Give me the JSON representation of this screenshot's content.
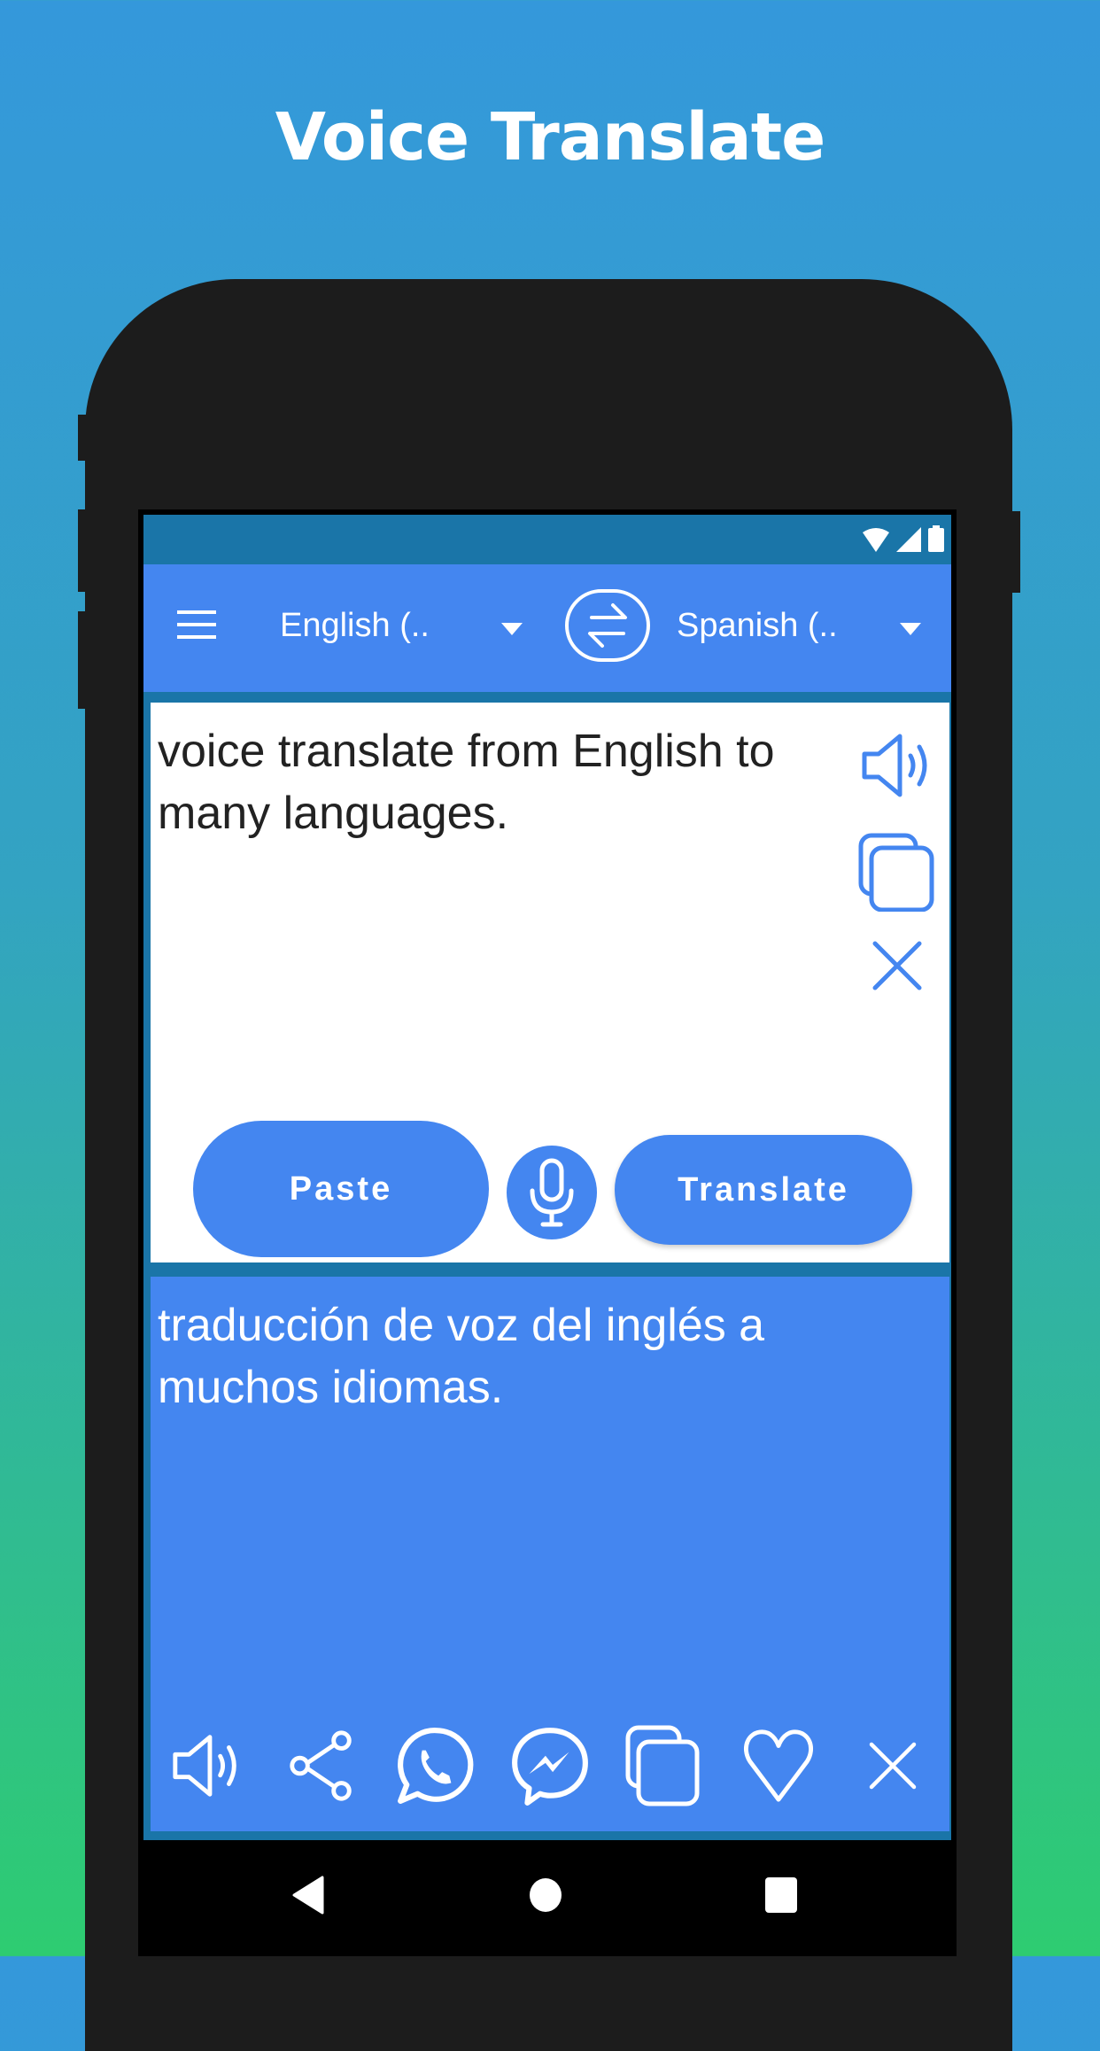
{
  "promo": {
    "title": "Voice Translate"
  },
  "status_bar": {
    "icons": [
      "wifi-icon",
      "signal-icon",
      "battery-icon"
    ]
  },
  "app_bar": {
    "menu_icon": "hamburger-menu-icon",
    "source_language": "English (..",
    "target_language": "Spanish (..",
    "swap_icon": "swap-languages-icon"
  },
  "input": {
    "text": "voice translate from English to many languages.",
    "actions": [
      "speaker-icon",
      "copy-icon",
      "clear-icon"
    ],
    "paste_label": "Paste",
    "translate_label": "Translate",
    "mic_icon": "microphone-icon"
  },
  "output": {
    "text": "traducción de voz del inglés a muchos idiomas.",
    "actions": [
      "speaker-icon",
      "share-icon",
      "whatsapp-icon",
      "messenger-icon",
      "copy-icon",
      "favorite-heart-icon",
      "clear-icon"
    ]
  },
  "colors": {
    "primary": "#4486f0",
    "primary_dark": "#1a75a8",
    "phone_body": "#1c1c1c",
    "bg_top": "#3498db",
    "bg_bottom": "#2ecc71"
  },
  "nav_bar": {
    "buttons": [
      "back-icon",
      "home-icon",
      "recents-icon"
    ]
  }
}
